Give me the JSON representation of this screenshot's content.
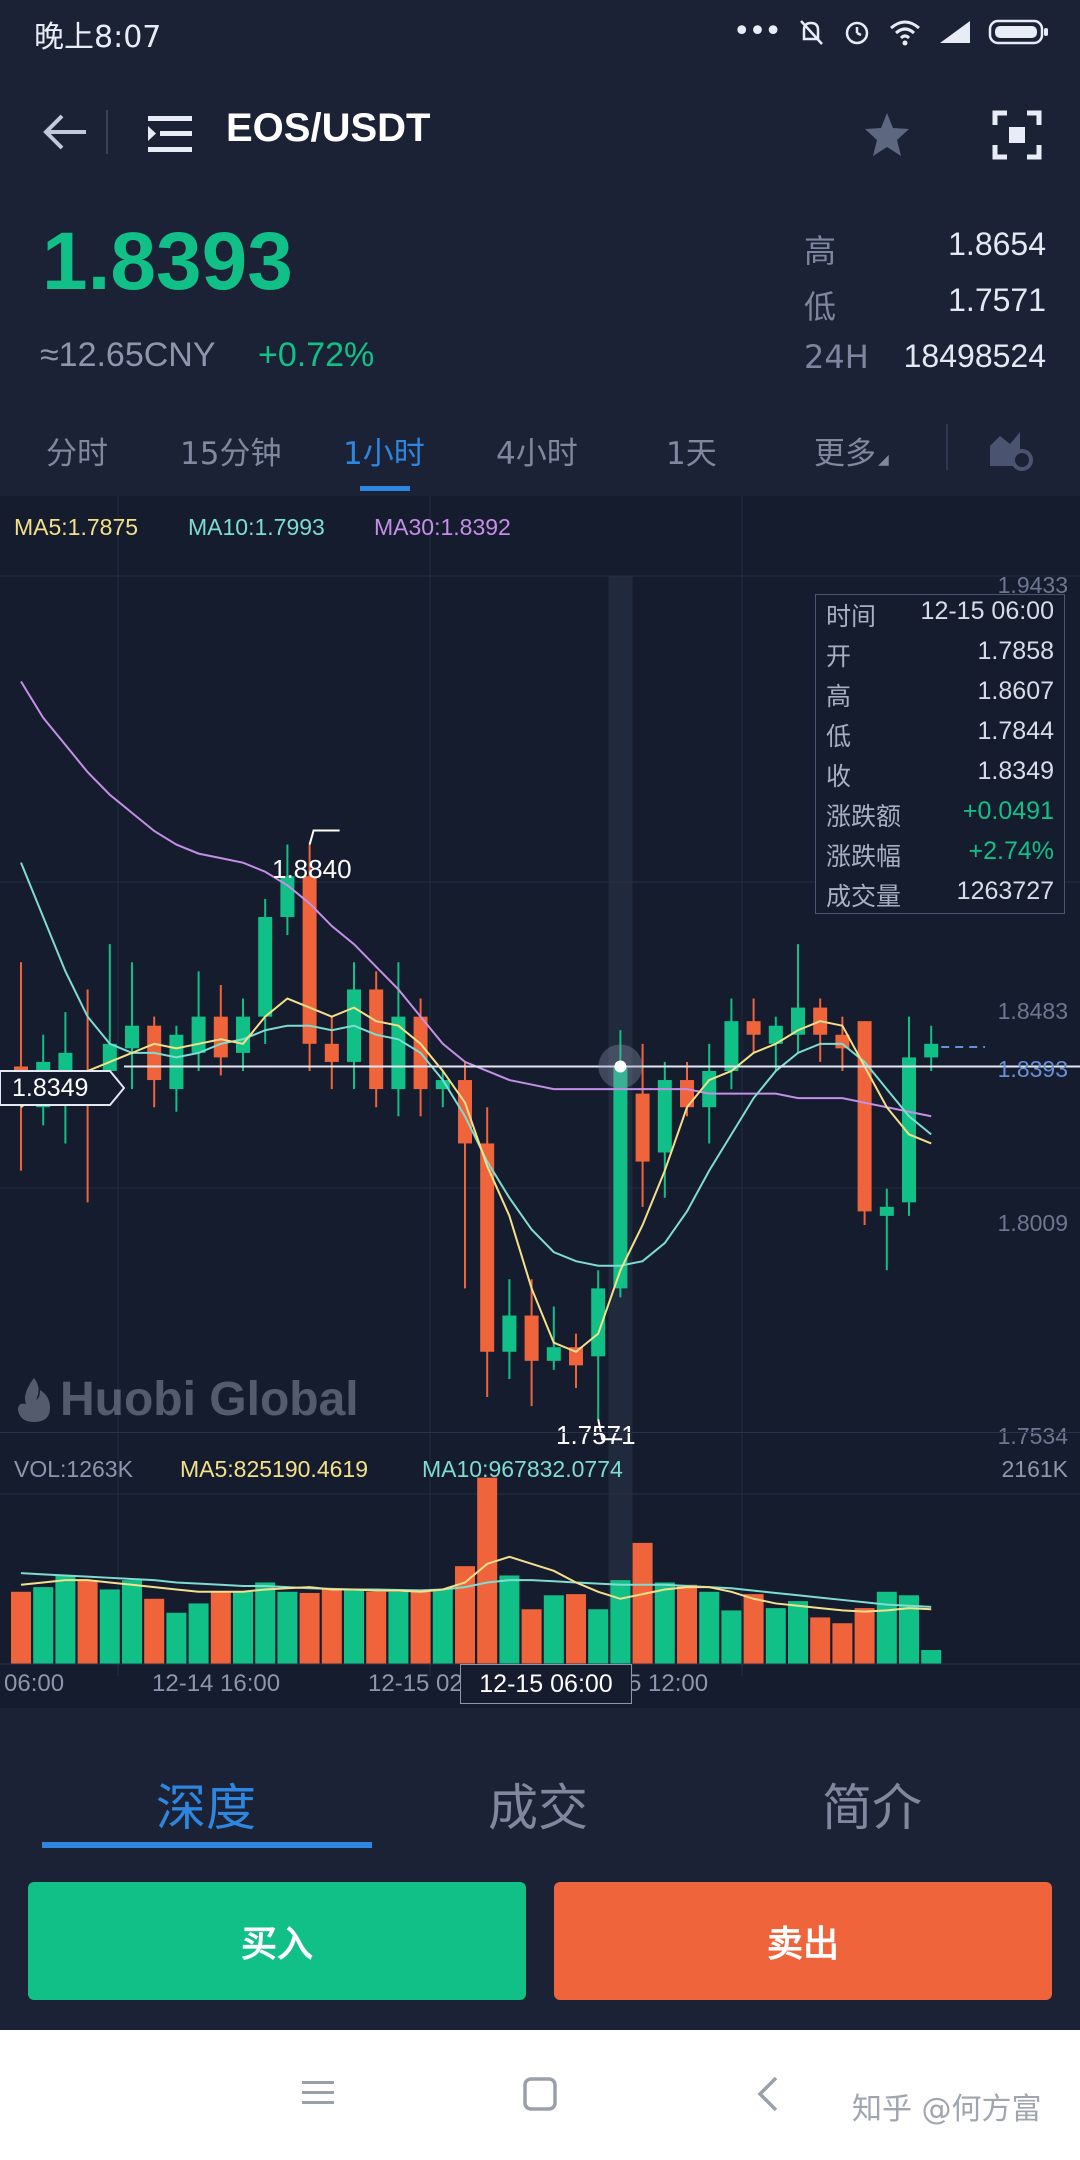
{
  "status_bar": {
    "time": "晚上8:07"
  },
  "header": {
    "pair": "EOS/USDT"
  },
  "ticker": {
    "price": "1.8393",
    "cny": "≈12.65CNY",
    "change": "+0.72%",
    "stats": [
      {
        "label": "高",
        "value": "1.8654"
      },
      {
        "label": "低",
        "value": "1.7571"
      },
      {
        "label": "24H",
        "value": "18498524"
      }
    ]
  },
  "period_tabs": [
    "分时",
    "15分钟",
    "1小时",
    "4小时",
    "1天",
    "更多"
  ],
  "active_period": "1小时",
  "legend": {
    "ma5": "MA5:1.7875",
    "ma10": "MA10:1.7993",
    "ma30": "MA30:1.8392"
  },
  "vol_legend": {
    "vol": "VOL:1263K",
    "ma5": "MA5:825190.4619",
    "ma10": "MA10:967832.0774",
    "max": "2161K"
  },
  "price_axis": [
    "1.9433",
    "1.8483",
    "1.8393",
    "1.8009",
    "1.7534"
  ],
  "markers": {
    "high": "1.8840",
    "low": "1.7571",
    "crosshair_price": "1.8349",
    "crosshair_time": "12-15 06:00"
  },
  "time_axis": [
    "06:00",
    "12-14 16:00",
    "12-15 02",
    "5 12:00"
  ],
  "watermark": "Huobi Global",
  "infobox": [
    {
      "label": "时间",
      "value": "12-15 06:00"
    },
    {
      "label": "开",
      "value": "1.7858"
    },
    {
      "label": "高",
      "value": "1.8607"
    },
    {
      "label": "低",
      "value": "1.7844"
    },
    {
      "label": "收",
      "value": "1.8349"
    },
    {
      "label": "涨跌额",
      "value": "+0.0491"
    },
    {
      "label": "涨跌幅",
      "value": "+2.74%"
    },
    {
      "label": "成交量",
      "value": "1263727"
    }
  ],
  "bottom_tabs": [
    "深度",
    "成交",
    "简介"
  ],
  "buy_label": "买入",
  "sell_label": "卖出",
  "nav_watermark": "知乎 @何方富",
  "colors": {
    "up": "#10c087",
    "down": "#f0643c",
    "accent": "#2d86e0",
    "ma5": "#f5e08a",
    "ma10": "#7fdcd0",
    "ma30": "#c48fe6"
  },
  "chart_data": {
    "type": "candlestick",
    "ylim": [
      1.7534,
      1.9433
    ],
    "candles": [
      {
        "o": 1.835,
        "c": 1.828,
        "h": 1.858,
        "l": 1.812
      },
      {
        "o": 1.826,
        "c": 1.836,
        "h": 1.842,
        "l": 1.822
      },
      {
        "o": 1.828,
        "c": 1.838,
        "h": 1.847,
        "l": 1.818
      },
      {
        "o": 1.832,
        "c": 1.828,
        "h": 1.852,
        "l": 1.805
      },
      {
        "o": 1.834,
        "c": 1.84,
        "h": 1.862,
        "l": 1.828
      },
      {
        "o": 1.839,
        "c": 1.844,
        "h": 1.858,
        "l": 1.83
      },
      {
        "o": 1.844,
        "c": 1.832,
        "h": 1.846,
        "l": 1.826
      },
      {
        "o": 1.83,
        "c": 1.842,
        "h": 1.844,
        "l": 1.825
      },
      {
        "o": 1.838,
        "c": 1.846,
        "h": 1.856,
        "l": 1.834
      },
      {
        "o": 1.846,
        "c": 1.837,
        "h": 1.853,
        "l": 1.833
      },
      {
        "o": 1.838,
        "c": 1.846,
        "h": 1.85,
        "l": 1.834
      },
      {
        "o": 1.846,
        "c": 1.868,
        "h": 1.872,
        "l": 1.84
      },
      {
        "o": 1.868,
        "c": 1.877,
        "h": 1.884,
        "l": 1.864
      },
      {
        "o": 1.877,
        "c": 1.84,
        "h": 1.884,
        "l": 1.834
      },
      {
        "o": 1.84,
        "c": 1.836,
        "h": 1.846,
        "l": 1.83
      },
      {
        "o": 1.836,
        "c": 1.852,
        "h": 1.858,
        "l": 1.83
      },
      {
        "o": 1.852,
        "c": 1.83,
        "h": 1.856,
        "l": 1.826
      },
      {
        "o": 1.83,
        "c": 1.846,
        "h": 1.858,
        "l": 1.824
      },
      {
        "o": 1.846,
        "c": 1.83,
        "h": 1.85,
        "l": 1.824
      },
      {
        "o": 1.83,
        "c": 1.832,
        "h": 1.834,
        "l": 1.826
      },
      {
        "o": 1.832,
        "c": 1.818,
        "h": 1.836,
        "l": 1.786
      },
      {
        "o": 1.818,
        "c": 1.772,
        "h": 1.826,
        "l": 1.762
      },
      {
        "o": 1.772,
        "c": 1.78,
        "h": 1.788,
        "l": 1.766
      },
      {
        "o": 1.78,
        "c": 1.77,
        "h": 1.788,
        "l": 1.76
      },
      {
        "o": 1.77,
        "c": 1.773,
        "h": 1.782,
        "l": 1.768
      },
      {
        "o": 1.773,
        "c": 1.769,
        "h": 1.776,
        "l": 1.764
      },
      {
        "o": 1.771,
        "c": 1.786,
        "h": 1.79,
        "l": 1.757
      },
      {
        "o": 1.786,
        "c": 1.835,
        "h": 1.843,
        "l": 1.784
      },
      {
        "o": 1.829,
        "c": 1.814,
        "h": 1.84,
        "l": 1.804
      },
      {
        "o": 1.816,
        "c": 1.832,
        "h": 1.836,
        "l": 1.806
      },
      {
        "o": 1.832,
        "c": 1.826,
        "h": 1.836,
        "l": 1.824
      },
      {
        "o": 1.826,
        "c": 1.834,
        "h": 1.84,
        "l": 1.818
      },
      {
        "o": 1.834,
        "c": 1.845,
        "h": 1.85,
        "l": 1.83
      },
      {
        "o": 1.845,
        "c": 1.842,
        "h": 1.85,
        "l": 1.838
      },
      {
        "o": 1.84,
        "c": 1.844,
        "h": 1.846,
        "l": 1.834
      },
      {
        "o": 1.842,
        "c": 1.848,
        "h": 1.862,
        "l": 1.838
      },
      {
        "o": 1.848,
        "c": 1.842,
        "h": 1.85,
        "l": 1.836
      },
      {
        "o": 1.842,
        "c": 1.839,
        "h": 1.846,
        "l": 1.834
      },
      {
        "o": 1.845,
        "c": 1.803,
        "h": 1.845,
        "l": 1.8
      },
      {
        "o": 1.802,
        "c": 1.804,
        "h": 1.808,
        "l": 1.79
      },
      {
        "o": 1.805,
        "c": 1.837,
        "h": 1.846,
        "l": 1.802
      },
      {
        "o": 1.837,
        "c": 1.84,
        "h": 1.844,
        "l": 1.834
      }
    ],
    "ma5": [
      1.826,
      1.83,
      1.831,
      1.834,
      1.836,
      1.838,
      1.84,
      1.839,
      1.84,
      1.841,
      1.84,
      1.846,
      1.85,
      1.848,
      1.846,
      1.848,
      1.845,
      1.844,
      1.84,
      1.834,
      1.827,
      1.813,
      1.802,
      1.786,
      1.774,
      1.772,
      1.776,
      1.79,
      1.8,
      1.812,
      1.826,
      1.832,
      1.834,
      1.838,
      1.84,
      1.843,
      1.845,
      1.844,
      1.835,
      1.826,
      1.82,
      1.818
    ],
    "ma10": [
      1.88,
      1.868,
      1.856,
      1.846,
      1.84,
      1.838,
      1.838,
      1.837,
      1.838,
      1.84,
      1.841,
      1.843,
      1.844,
      1.844,
      1.843,
      1.844,
      1.842,
      1.841,
      1.838,
      1.832,
      1.824,
      1.814,
      1.806,
      1.799,
      1.794,
      1.792,
      1.791,
      1.791,
      1.792,
      1.796,
      1.803,
      1.812,
      1.82,
      1.828,
      1.834,
      1.838,
      1.84,
      1.84,
      1.836,
      1.83,
      1.824,
      1.82
    ],
    "ma30": [
      1.92,
      1.912,
      1.906,
      1.9,
      1.895,
      1.891,
      1.887,
      1.884,
      1.882,
      1.881,
      1.88,
      1.878,
      1.875,
      1.871,
      1.866,
      1.862,
      1.857,
      1.852,
      1.846,
      1.84,
      1.836,
      1.834,
      1.832,
      1.831,
      1.83,
      1.83,
      1.83,
      1.83,
      1.83,
      1.83,
      1.83,
      1.829,
      1.829,
      1.829,
      1.829,
      1.828,
      1.828,
      1.828,
      1.827,
      1.826,
      1.825,
      1.824
    ],
    "volume": [
      620,
      660,
      760,
      720,
      640,
      720,
      560,
      440,
      520,
      620,
      620,
      700,
      620,
      610,
      640,
      640,
      620,
      620,
      620,
      640,
      840,
      1600,
      760,
      470,
      590,
      600,
      470,
      720,
      1040,
      700,
      680,
      620,
      460,
      600,
      480,
      540,
      400,
      350,
      480,
      620,
      590,
      120
    ],
    "vol_ma5": [
      680,
      700,
      720,
      720,
      700,
      680,
      660,
      640,
      620,
      620,
      620,
      640,
      650,
      660,
      640,
      640,
      630,
      630,
      620,
      640,
      700,
      860,
      920,
      860,
      800,
      700,
      620,
      560,
      600,
      640,
      660,
      660,
      620,
      560,
      520,
      500,
      480,
      460,
      450,
      460,
      480,
      470
    ],
    "vol_ma10": [
      780,
      770,
      760,
      750,
      740,
      730,
      720,
      700,
      690,
      680,
      670,
      670,
      660,
      650,
      645,
      640,
      640,
      635,
      632,
      640,
      660,
      700,
      720,
      720,
      710,
      700,
      690,
      680,
      680,
      680,
      670,
      660,
      650,
      630,
      610,
      590,
      570,
      550,
      530,
      510,
      500,
      490
    ]
  }
}
